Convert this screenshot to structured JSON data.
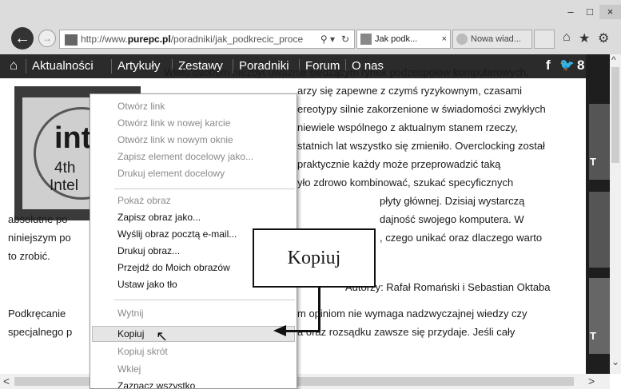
{
  "window": {
    "minimize_glyph": "–",
    "maximize_glyph": "□",
    "close_glyph": "×"
  },
  "nav_buttons": {
    "back_glyph": "←",
    "forward_glyph": "→"
  },
  "address_bar": {
    "url_prefix": "http://www.",
    "url_domain": "purepc.pl",
    "url_rest": "/poradniki/jak_podkrecic_proce",
    "search_glyph": "⚲ ▾",
    "refresh_glyph": "↻",
    "favicon": "purepc-favicon-icon"
  },
  "tabs": [
    {
      "label": "Jak podk...",
      "close": "×"
    },
    {
      "label": "Nowa wiad...",
      "close": ""
    },
    {
      "label": "",
      "close": ""
    }
  ],
  "toolbar_icons": {
    "home": "⌂",
    "favorites": "★",
    "settings": "⚙"
  },
  "site_nav": {
    "home_glyph": "⌂",
    "items": [
      "Aktualności",
      "Artykuły",
      "Zestawy",
      "Poradniki",
      "Forum",
      "O nas"
    ],
    "social_f": "f",
    "social_twitter": "🐦",
    "social_g": "8"
  },
  "strip": {
    "letter1": "T",
    "letter2": "T"
  },
  "image": {
    "logo": "int",
    "gen": "4th",
    "brand": "Intel"
  },
  "article": {
    "lines_right": [
      "Wielu osobom niezbyt uważnie śledzącym rynek podzespołów komputerowych,",
      "arzy się zapewne z czymś ryzykownym, czasami",
      "ereotypy silnie zakorzenione w świadomości zwykłych",
      "niewiele wspólnego z aktualnym stanem rzeczy,",
      "statnich lat wszystko się zmieniło. Overclocking został",
      "praktycznie każdy może przeprowadzić taką",
      "yło zdrowo kombinować, szukać specyficznych",
      "płyty głównej. Dzisiaj wystarczą",
      "dajność swojego komputera. W",
      ", czego unikać oraz dlaczego warto"
    ],
    "lines_left": [
      "absolutne po",
      "niniejszym po",
      "to zrobić."
    ],
    "authors": "Autorzy: Rafał Romański i Sebastian Oktaba",
    "para2_left": [
      "Podkręcanie",
      "specjalnego p"
    ],
    "para2_right": [
      "m opiniom nie wymaga nadzwyczajnej wiedzy czy",
      "a oraz rozsądku zawsze się przydaje. Jeśli cały"
    ]
  },
  "context_menu": {
    "items": [
      {
        "label": "Otwórz link",
        "disabled": true
      },
      {
        "label": "Otwórz link w nowej karcie",
        "disabled": true
      },
      {
        "label": "Otwórz link w nowym oknie",
        "disabled": true
      },
      {
        "label": "Zapisz element docelowy jako...",
        "disabled": true
      },
      {
        "label": "Drukuj element docelowy",
        "disabled": true
      },
      {
        "label": "Pokaż obraz",
        "disabled": true
      },
      {
        "label": "Zapisz obraz jako...",
        "disabled": false
      },
      {
        "label": "Wyślij obraz pocztą e-mail...",
        "disabled": false
      },
      {
        "label": "Drukuj obraz...",
        "disabled": false
      },
      {
        "label": "Przejdź do Moich obrazów",
        "disabled": false
      },
      {
        "label": "Ustaw jako tło",
        "disabled": false
      },
      {
        "label": "Wytnij",
        "disabled": true
      },
      {
        "label": "Kopiuj",
        "disabled": false
      },
      {
        "label": "Kopiuj skrót",
        "disabled": true
      },
      {
        "label": "Wklej",
        "disabled": true
      },
      {
        "label": "Zaznacz wszystko",
        "disabled": false
      }
    ],
    "highlighted": "Kopiuj"
  },
  "callout": {
    "label": "Kopiuj"
  },
  "cursor_glyph": "↖",
  "scroll": {
    "up": "^",
    "down": "⌄",
    "left": "<",
    "right": ">"
  }
}
